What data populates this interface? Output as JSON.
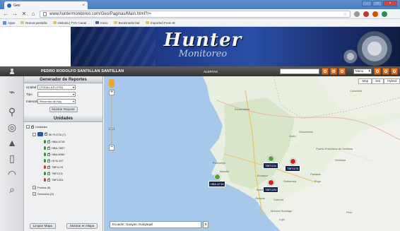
{
  "browser": {
    "tab_title": "Geo",
    "tab_close": "×",
    "url": "www.huntermonitoreo.com/Geo/Paginas/Main.html?r=",
    "bookmarks": [
      "Apps",
      "Nueva pestaña",
      "Historia | TVS Canal ...",
      "Inicio",
      "Bookmarks bar",
      "Imported From IE"
    ]
  },
  "brand": {
    "name": "Hunter",
    "subtitle": "Monitoreo"
  },
  "userbar": {
    "user_name": "PEDRO RODOLFO SANTILLAN SANTILLAN",
    "alerts_label": "ALERTAS",
    "menu_value": "Menu"
  },
  "report": {
    "title": "Generador de Reportes",
    "fields": [
      {
        "label": "Unidad",
        "value": "(TODA LA FLOTA)"
      },
      {
        "label": "Tipo",
        "value": ""
      },
      {
        "label": "Intervalo",
        "value": "Recorrido de Hoy"
      }
    ],
    "show_button": "Mostrar Reporte"
  },
  "units": {
    "title": "Unidades",
    "root_label": "Unidades",
    "fleet_label": "MI FLOTA (7)",
    "vehicles": [
      "HBA-6718",
      "HBA-7657",
      "HBA-6060",
      "HCN-197",
      "TBF1176",
      "TBF1211",
      "TBF1224"
    ],
    "points_label": "Puntos (0)",
    "sensors_label": "Sensores (0)",
    "clear_button": "Limpiar Mapa",
    "show_button": "Mostrar en Mapa"
  },
  "map": {
    "controls": [
      "Map",
      "Sat",
      "Hybrid"
    ],
    "places": {
      "colombia": "Colombia",
      "esmeraldas": "Esmeraldas",
      "ecuador": "Ecuador",
      "sucumbios": "Sucumbíos",
      "orellana": "Orellana",
      "pastaza": "Pastaza",
      "morona": "Morona Santiago",
      "loja": "Loja",
      "guayas": "Guayas",
      "manabi": "Manabí",
      "peru": "Perú",
      "puerto": "Puerto Francisco de Orellana",
      "riobamba": "Riobamba",
      "babahoyo": "Babahoyo",
      "portoviejo": "Portoviejo",
      "tena": "Tena",
      "puyo": "Puyo",
      "cuenca": "Cuenca",
      "quito": "Quito"
    },
    "vehicles": [
      {
        "label": "HBA-6718",
        "status": "green"
      },
      {
        "label": "TBF1211",
        "status": "green"
      },
      {
        "label": "TBF1176",
        "status": "red"
      },
      {
        "label": "TBF1224",
        "status": "red"
      }
    ],
    "address": "Ecuador, Guayas, Guayaquil",
    "address_button": "x"
  },
  "colors": {
    "accent_orange": "#e8731f",
    "status_green": "#52a43a",
    "status_red": "#d32222",
    "header_dark": "#3c3c3c",
    "banner_blue": "#1f3b8c"
  }
}
